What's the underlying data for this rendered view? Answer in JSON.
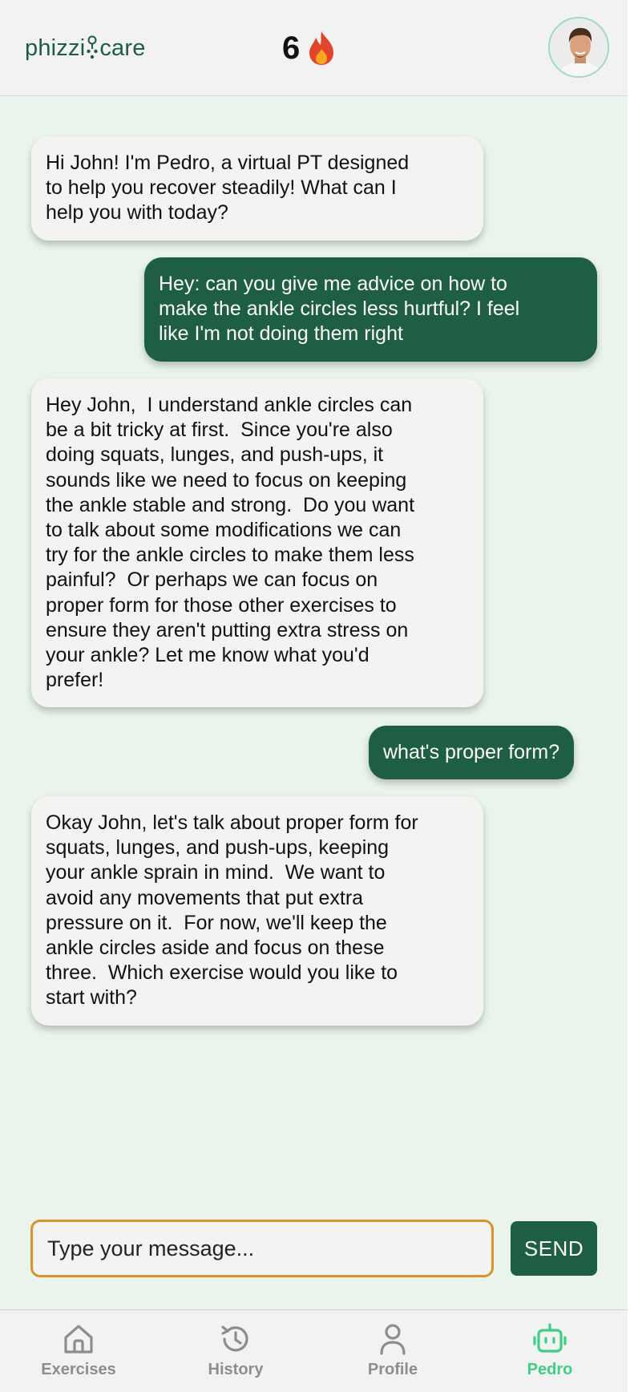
{
  "header": {
    "logo_left": "phizzi",
    "logo_right": "care",
    "streak_count": "6",
    "streak_icon": "flame-icon",
    "avatar_icon": "user-avatar"
  },
  "messages": [
    {
      "sender": "bot",
      "text": "Hi John! I'm Pedro, a virtual PT designed\nto help you recover steadily! What can I\nhelp you with today?"
    },
    {
      "sender": "user",
      "text": "Hey: can you give me advice on how to\nmake the ankle circles less hurtful? I feel\nlike I'm not doing them right"
    },
    {
      "sender": "bot",
      "text": "Hey John,  I understand ankle circles can\nbe a bit tricky at first.  Since you're also\ndoing squats, lunges, and push-ups, it\nsounds like we need to focus on keeping\nthe ankle stable and strong.  Do you want\nto talk about some modifications we can\ntry for the ankle circles to make them less\npainful?  Or perhaps we can focus on\nproper form for those other exercises to\nensure they aren't putting extra stress on\nyour ankle? Let me know what you'd\nprefer!"
    },
    {
      "sender": "user",
      "text": "what's proper form?"
    },
    {
      "sender": "bot",
      "text": "Okay John, let's talk about proper form for\nsquats, lunges, and push-ups, keeping\nyour ankle sprain in mind.  We want to\navoid any movements that put extra\npressure on it.  For now, we'll keep the\nankle circles aside and focus on these\nthree.  Which exercise would you like to\nstart with?"
    }
  ],
  "composer": {
    "placeholder": "Type your message...",
    "value": "",
    "send_label": "SEND"
  },
  "nav": {
    "items": [
      {
        "label": "Exercises",
        "icon": "home-icon",
        "active": false
      },
      {
        "label": "History",
        "icon": "history-icon",
        "active": false
      },
      {
        "label": "Profile",
        "icon": "user-icon",
        "active": false
      },
      {
        "label": "Pedro",
        "icon": "robot-icon",
        "active": true
      }
    ]
  },
  "colors": {
    "brand_green": "#1d5e44",
    "active_tab": "#3fcf84",
    "background": "#e8f4ec",
    "input_border": "#d9922e"
  }
}
